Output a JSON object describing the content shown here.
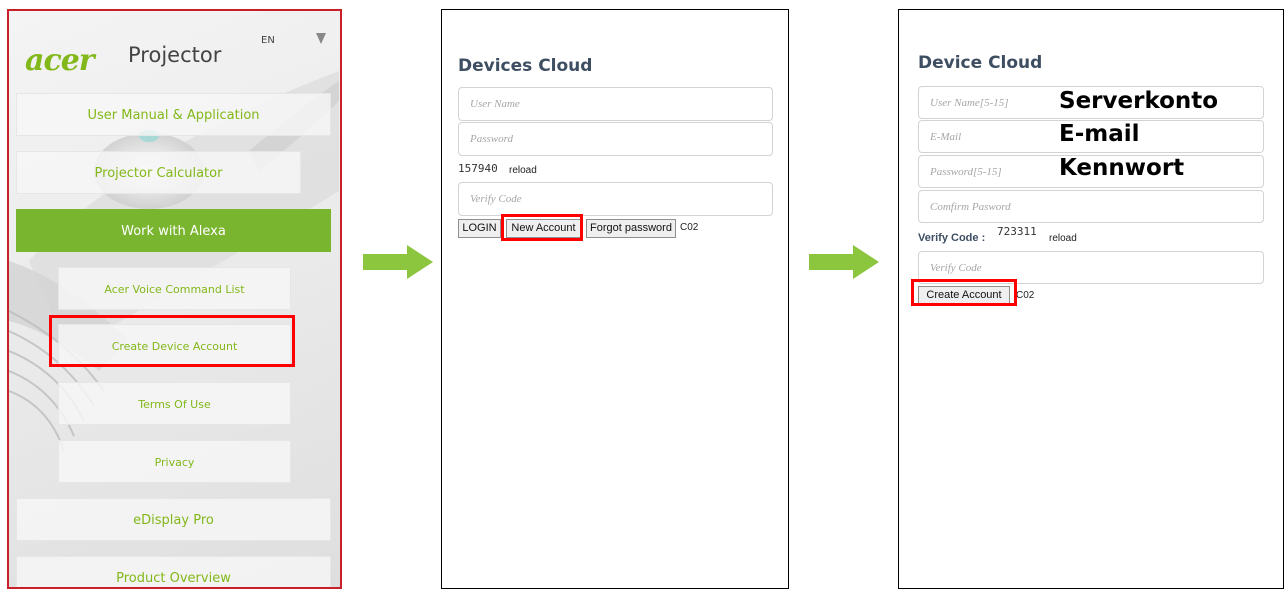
{
  "app": {
    "brand": "acer",
    "title": "Projector",
    "language": "EN",
    "menu": [
      "User Manual & Application",
      "Projector Calculator",
      "Work with Alexa",
      "Acer Voice Command List",
      "Create Device Account",
      "Terms Of Use",
      "Privacy",
      "eDisplay Pro",
      "Product Overview"
    ],
    "active_item": "Work with Alexa"
  },
  "login": {
    "title": "Devices Cloud",
    "username_placeholder": "User Name",
    "password_placeholder": "Password",
    "captcha": "157940",
    "reload": "reload",
    "verify_placeholder": "Verify Code",
    "buttons": {
      "login": "LOGIN",
      "new_account": "New Account",
      "forgot": "Forgot password"
    },
    "code": "C02"
  },
  "create": {
    "title": "Device Cloud",
    "username_placeholder": "User Name[5-15]",
    "email_placeholder": "E-Mail",
    "password_placeholder": "Password[5-15]",
    "confirm_placeholder": "Comfirm Pasword",
    "verify_label": "Verify Code :",
    "captcha": "723311",
    "reload": "reload",
    "verify_placeholder": "Verify Code",
    "button": "Create Account",
    "code": "C02"
  },
  "annotations": {
    "username": "Serverkonto",
    "email": "E-mail",
    "password": "Kennwort"
  },
  "colors": {
    "acer_green": "#83b81a",
    "active_green": "#7ab530",
    "highlight_red": "#ff0000",
    "panel_border_red": "#c8202a",
    "arrow_green": "#8cc63f"
  }
}
